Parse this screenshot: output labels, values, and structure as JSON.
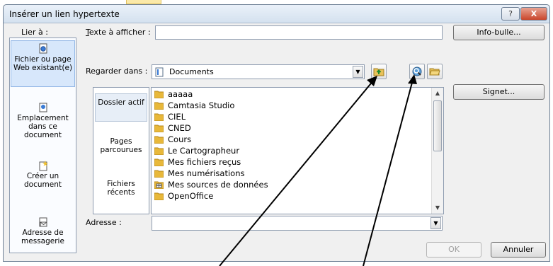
{
  "window": {
    "title": "Insérer un lien hypertexte",
    "help_glyph": "?",
    "close_glyph": "X"
  },
  "link_to": {
    "label": "Lier à :",
    "items": [
      {
        "label": "Fichier ou page Web existant(e)",
        "icon": "existing-file-icon",
        "active": true
      },
      {
        "label": "Emplacement dans ce document",
        "icon": "place-in-document-icon",
        "active": false
      },
      {
        "label": "Créer un document",
        "icon": "create-document-icon",
        "active": false
      },
      {
        "label": "Adresse de messagerie",
        "icon": "email-address-icon",
        "active": false
      }
    ]
  },
  "text_to_display": {
    "label": "Texte à afficher :",
    "value": ""
  },
  "screentip_button": "Info-bulle...",
  "look_in": {
    "label": "Regarder dans :",
    "value": "Documents"
  },
  "bookmark_button": "Signet...",
  "nav_items": [
    {
      "label": "Dossier actif",
      "active": true
    },
    {
      "label": "Pages parcourues",
      "active": false
    },
    {
      "label": "Fichiers récents",
      "active": false
    }
  ],
  "files": [
    {
      "name": "aaaaa",
      "icon": "folder-icon"
    },
    {
      "name": "Camtasia Studio",
      "icon": "folder-icon"
    },
    {
      "name": "CIEL",
      "icon": "folder-icon"
    },
    {
      "name": "CNED",
      "icon": "folder-icon"
    },
    {
      "name": "Cours",
      "icon": "folder-icon"
    },
    {
      "name": "Le Cartographeur",
      "icon": "folder-icon"
    },
    {
      "name": "Mes fichiers reçus",
      "icon": "folder-icon"
    },
    {
      "name": "Mes numérisations",
      "icon": "folder-icon"
    },
    {
      "name": "Mes sources de données",
      "icon": "data-source-icon"
    },
    {
      "name": "OpenOffice",
      "icon": "folder-icon"
    }
  ],
  "address": {
    "label": "Adresse :",
    "value": ""
  },
  "ok_button": "OK",
  "cancel_button": "Annuler",
  "colors": {
    "folder": "#e8b83a",
    "accent": "#93b7e6",
    "arrow": "#000000"
  }
}
